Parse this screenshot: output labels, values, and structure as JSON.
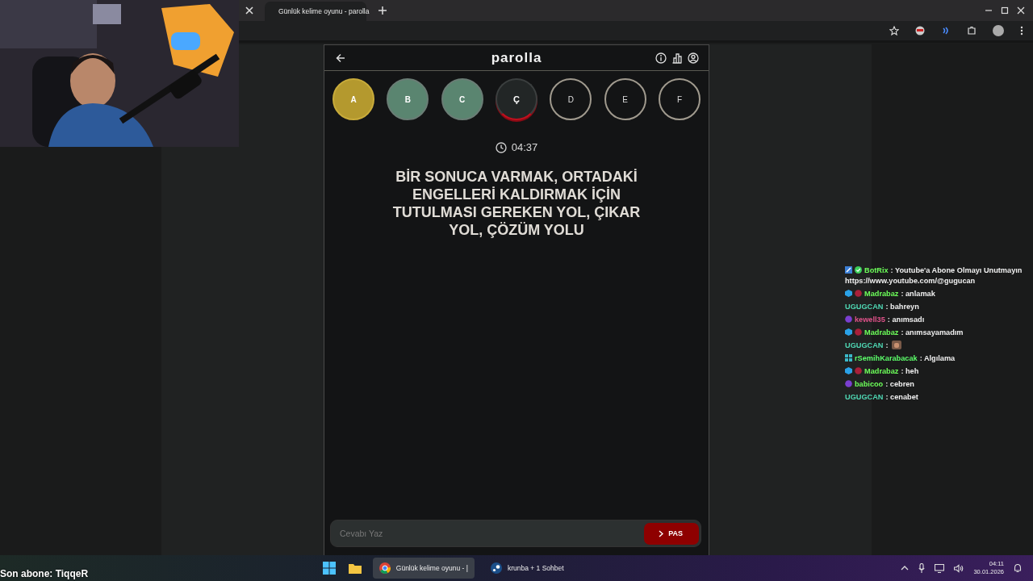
{
  "overlay": {
    "last_subscriber": "Son abone: TiqqeR"
  },
  "browser": {
    "tabs": [
      {
        "title": "Günlük kelime oyunu - parolla",
        "selected": true
      }
    ]
  },
  "app": {
    "title": "parolla",
    "letters": [
      {
        "letter": "A",
        "kind": "passed"
      },
      {
        "letter": "B",
        "kind": "correct"
      },
      {
        "letter": "C",
        "kind": "correct"
      },
      {
        "letter": "Ç",
        "kind": "current"
      },
      {
        "letter": "D",
        "kind": "pending"
      },
      {
        "letter": "E",
        "kind": "pending"
      },
      {
        "letter": "F",
        "kind": "pending"
      }
    ],
    "timer": "04:37",
    "question": "BİR SONUCA VARMAK, ORTADAKİ ENGELLERİ KALDIRMAK İÇİN TUTULMASI GEREKEN YOL, ÇIKAR YOL, ÇÖZÜM YOLU",
    "answer": {
      "placeholder": "Cevabı Yaz"
    },
    "pass_button": "PAS"
  },
  "chat": [
    {
      "user": "BotRix",
      "color": "#6dff5a",
      "badges": [
        {
          "kind": "bot"
        },
        {
          "kind": "check"
        }
      ],
      "text": ": Youtube'a Abone Olmayı Unutmayın",
      "link": "https://www.youtube.com/@gugucan"
    },
    {
      "user": "Madrabaz",
      "color": "#6dff5a",
      "badges": [
        {
          "kind": "cube"
        },
        {
          "kind": "gem"
        }
      ],
      "text": ": anlamak"
    },
    {
      "user": "UGUGCAN",
      "color": "#4fd8b4",
      "text": ": bahreyn"
    },
    {
      "user": "kewell35",
      "color": "#e0528a",
      "badges": [
        {
          "kind": "orb"
        }
      ],
      "text": ": anımsadı"
    },
    {
      "user": "Madrabaz",
      "color": "#6dff5a",
      "badges": [
        {
          "kind": "cube"
        },
        {
          "kind": "gem"
        }
      ],
      "text": ": anımsayamadım"
    },
    {
      "user": "UGUGCAN",
      "color": "#4fd8b4",
      "text": ":",
      "emote": true
    },
    {
      "user": "rSemihKarabacak",
      "color": "#5cff6a",
      "badges": [
        {
          "kind": "grid"
        }
      ],
      "text": ": Algılama"
    },
    {
      "user": "Madrabaz",
      "color": "#6dff5a",
      "badges": [
        {
          "kind": "cube"
        },
        {
          "kind": "gem"
        }
      ],
      "text": ": heh"
    },
    {
      "user": "babicoo",
      "color": "#6dff5a",
      "badges": [
        {
          "kind": "orb"
        }
      ],
      "text": ": cebren"
    },
    {
      "user": "UGUGCAN",
      "color": "#4fd8b4",
      "text": ": cenabet"
    }
  ],
  "taskbar": {
    "apps": [
      {
        "kind": "chrome",
        "label": "Günlük kelime oyunu - |",
        "selected": true
      },
      {
        "kind": "steam",
        "label": "krunba + 1 Sohbet",
        "selected": false
      }
    ],
    "time": "04:11",
    "date": "30.01.2026"
  }
}
